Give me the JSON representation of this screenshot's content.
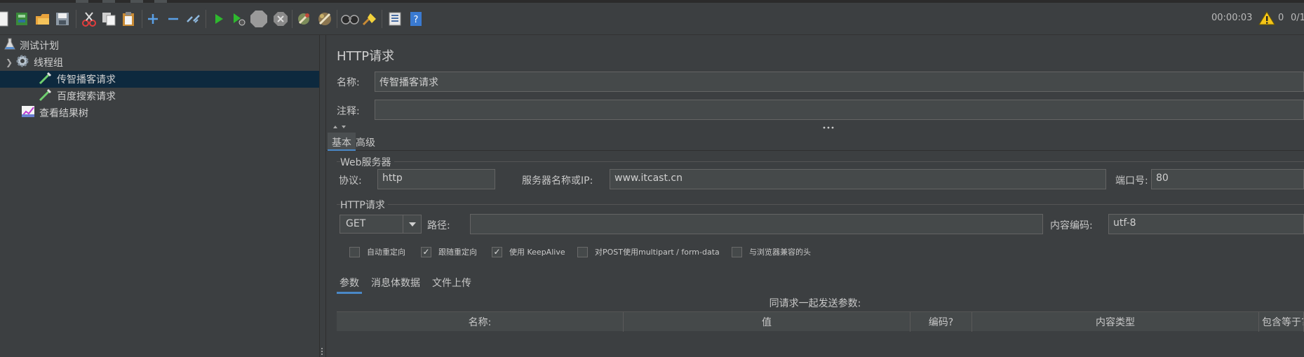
{
  "toolbar": {
    "timer": "00:00:03",
    "warnings": "0",
    "threads": "0/1",
    "icons": [
      "new-icon",
      "templates-icon",
      "open-icon",
      "save-icon",
      "cut-icon",
      "copy-icon",
      "paste-icon",
      "expand-icon",
      "collapse-icon",
      "toggle-icon",
      "start-icon",
      "start-no-pause-icon",
      "stop-icon",
      "shutdown-icon",
      "clear-icon",
      "clear-all-icon",
      "search-icon",
      "reset-search-icon",
      "function-helper-icon",
      "help-icon"
    ]
  },
  "tree": {
    "items": [
      {
        "label": "测试计划"
      },
      {
        "label": "线程组"
      },
      {
        "label": "传智播客请求"
      },
      {
        "label": "百度搜索请求"
      },
      {
        "label": "查看结果树"
      }
    ]
  },
  "panel": {
    "title": "HTTP请求",
    "name_label": "名称:",
    "name_value": "传智播客请求",
    "comment_label": "注释:",
    "comment_value": "",
    "tabs": [
      "基本",
      "高级"
    ],
    "web_server": {
      "title": "Web服务器",
      "protocol_label": "协议:",
      "protocol_value": "http",
      "server_label": "服务器名称或IP:",
      "server_value": "www.itcast.cn",
      "port_label": "端口号:",
      "port_value": "80"
    },
    "http_request": {
      "title": "HTTP请求",
      "method": "GET",
      "path_label": "路径:",
      "path_value": "",
      "encoding_label": "内容编码:",
      "encoding_value": "utf-8"
    },
    "checkboxes": [
      {
        "label": "自动重定向",
        "checked": false
      },
      {
        "label": "跟随重定向",
        "checked": true
      },
      {
        "label": "使用 KeepAlive",
        "checked": true
      },
      {
        "label": "对POST使用multipart / form-data",
        "checked": false
      },
      {
        "label": "与浏览器兼容的头",
        "checked": false
      }
    ],
    "subtabs": [
      "参数",
      "消息体数据",
      "文件上传"
    ],
    "table_caption": "同请求一起发送参数:",
    "columns": [
      "名称:",
      "值",
      "编码?",
      "内容类型",
      "包含等于?"
    ]
  },
  "colors": {
    "background": "#3c3f41",
    "selection": "#0d293e",
    "accent": "#4a88c7",
    "field": "#45494a"
  }
}
